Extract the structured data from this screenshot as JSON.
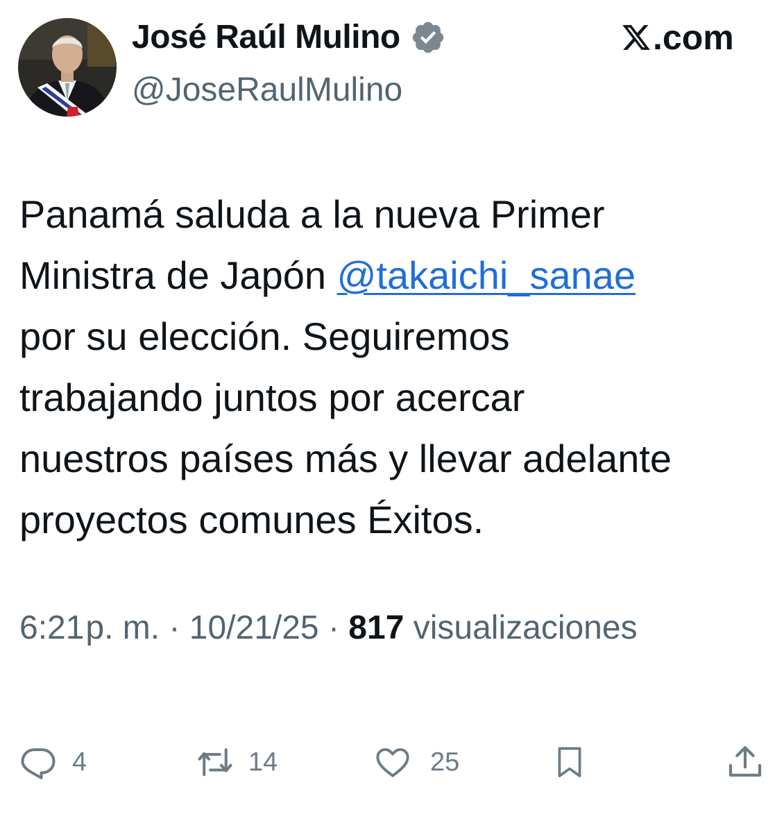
{
  "header": {
    "display_name": "José Raúl Mulino",
    "handle": "@JoseRaulMulino",
    "site": ".com",
    "verified_icon": "verified-badge-icon",
    "x_icon": "x-logo-icon"
  },
  "tweet": {
    "text_before": "Panamá saluda a  la nueva Primer\nMinistra de Japón ",
    "mention": "@takaichi_sanae",
    "text_after": "\npor su elección. Seguiremos\ntrabajando juntos por acercar\nnuestros países más y llevar adelante\nproyectos comunes   Éxitos."
  },
  "meta": {
    "time": "6:21",
    "ampm": "p. m.",
    "separator": "·",
    "date": "10/21/25",
    "views_count": "817",
    "views_label": "visualizaciones"
  },
  "actions": {
    "replies": "4",
    "reposts": "14",
    "likes": "25"
  },
  "colors": {
    "link": "#1d6fd8",
    "secondary": "#536471",
    "text": "#0f1419"
  }
}
